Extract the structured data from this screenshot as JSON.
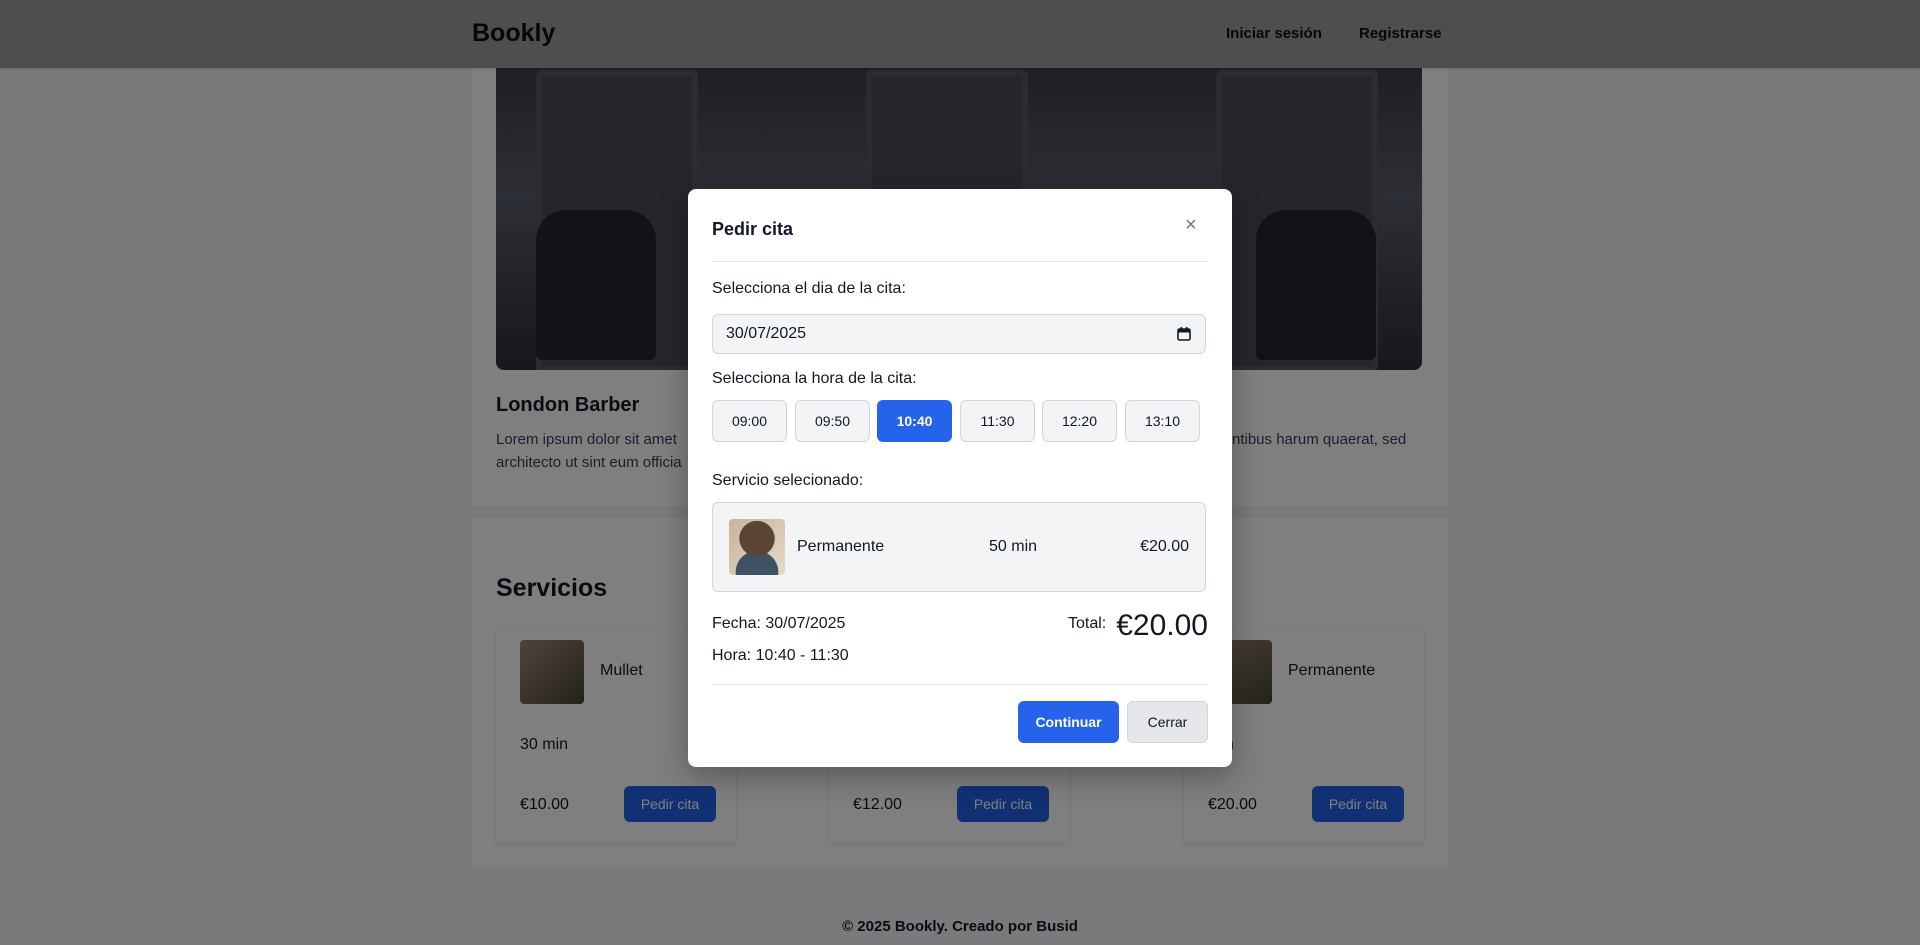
{
  "navbar": {
    "brand": "Bookly",
    "login": "Iniciar sesión",
    "register": "Registrarse"
  },
  "shop": {
    "name": "London Barber",
    "description_left": "Lorem ipsum dolor sit amet architecto ut sint eum officia",
    "description_right": "ntibus harum quaerat, sed"
  },
  "services": {
    "title": "Servicios",
    "cards": [
      {
        "name": "Mullet",
        "duration": "30 min",
        "price": "€10.00",
        "button": "Pedir cita"
      },
      {
        "name": "",
        "duration": "",
        "price": "€12.00",
        "button": "Pedir cita"
      },
      {
        "name": "Permanente",
        "duration": "min",
        "price": "€20.00",
        "button": "Pedir cita"
      }
    ]
  },
  "footer": {
    "text": "© 2025 Bookly. Creado por Busid"
  },
  "modal": {
    "title": "Pedir cita",
    "close_icon": "×",
    "date_label": "Selecciona el dia de la cita:",
    "date_value": "30/07/2025",
    "time_label": "Selecciona la hora de la cita:",
    "time_slots": [
      "09:00",
      "09:50",
      "10:40",
      "11:30",
      "12:20",
      "13:10"
    ],
    "selected_slot": "10:40",
    "service_label": "Servicio selecionado:",
    "service": {
      "name": "Permanente",
      "duration": "50 min",
      "price": "€20.00"
    },
    "fecha": "Fecha: 30/07/2025",
    "hora": "Hora: 10:40 - 11:30",
    "total_label": "Total:",
    "total_value": "€20.00",
    "continue_button": "Continuar",
    "close_button": "Cerrar"
  },
  "colors": {
    "accent": "#2563eb",
    "overlay": "rgba(0,0,0,0.5)"
  }
}
